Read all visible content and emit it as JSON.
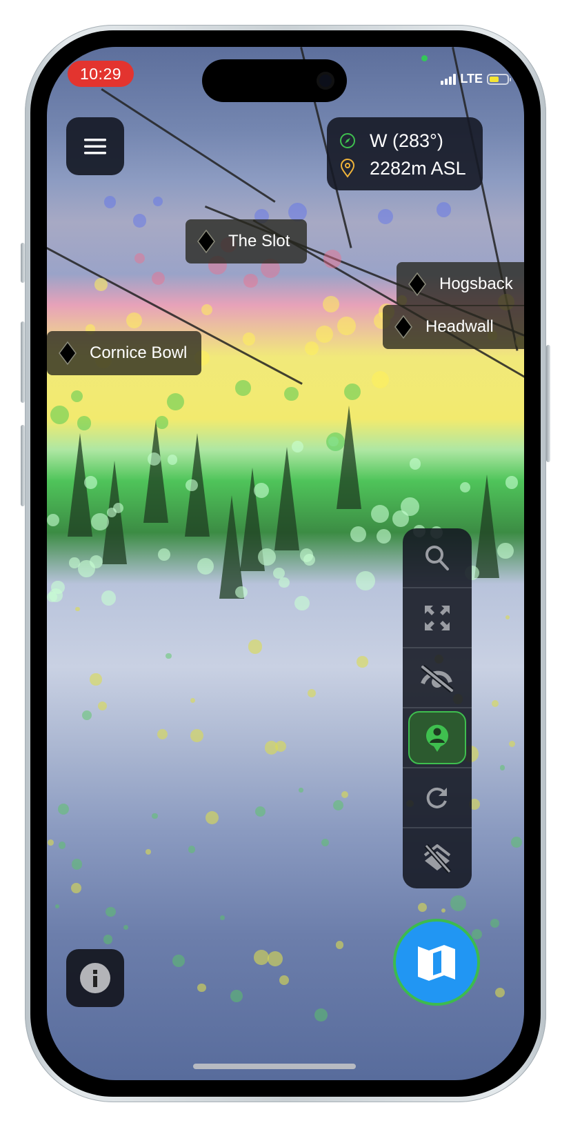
{
  "status_bar": {
    "time": "10:29",
    "network": "LTE",
    "signal_bars": 4,
    "battery_level": 0.55,
    "battery_color": "#f5e533",
    "time_pill_color": "#e3342f"
  },
  "header": {
    "menu_icon": "hamburger-menu-icon",
    "heading": {
      "icon": "compass-icon",
      "icon_color": "#3fbf4f",
      "value": "W (283°)"
    },
    "altitude": {
      "icon": "location-pin-icon",
      "icon_color": "#f0b43a",
      "value": "2282m ASL"
    }
  },
  "trail_labels": [
    {
      "name": "The Slot",
      "difficulty": "black-diamond"
    },
    {
      "name": "Hogsback",
      "difficulty": "black-diamond"
    },
    {
      "name": "Headwall",
      "difficulty": "black-diamond"
    },
    {
      "name": "Cornice Bowl",
      "difficulty": "black-diamond"
    }
  ],
  "toolbar": {
    "items": [
      {
        "id": "search",
        "icon": "search-icon",
        "active": false
      },
      {
        "id": "fullscreen",
        "icon": "expand-icon",
        "active": false
      },
      {
        "id": "hide-overlay",
        "icon": "eye-slash-icon",
        "active": false
      },
      {
        "id": "user-location",
        "icon": "user-location-icon",
        "active": true
      },
      {
        "id": "refresh",
        "icon": "refresh-icon",
        "active": false
      },
      {
        "id": "layers-off",
        "icon": "layers-off-icon",
        "active": false
      }
    ],
    "active_color": "#3fbf4f"
  },
  "bottom": {
    "info_icon": "info-icon",
    "map_icon": "map-icon",
    "map_button_color": "#2196f3"
  }
}
